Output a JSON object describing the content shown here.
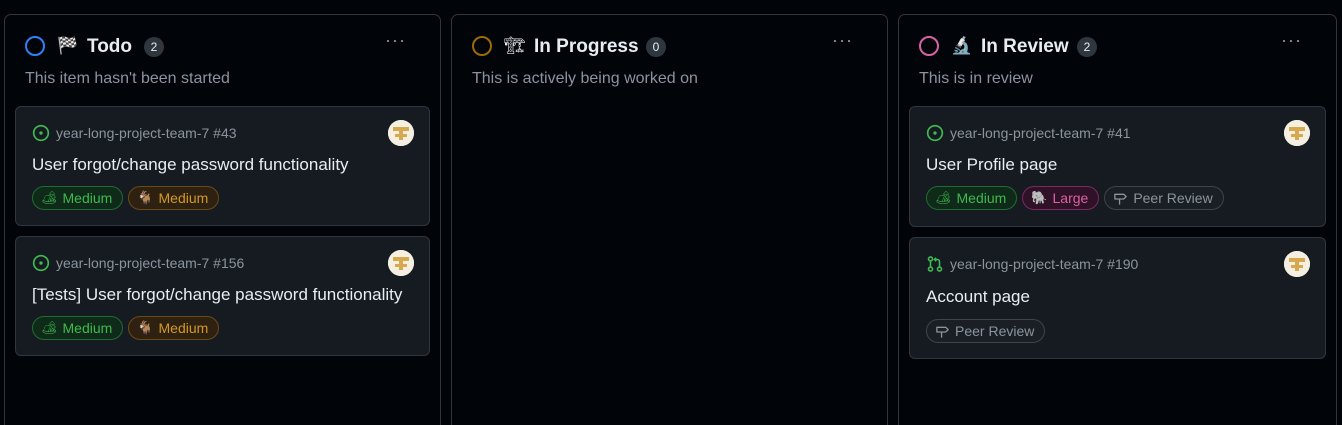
{
  "columns": [
    {
      "title": "Todo",
      "emoji": "🏁",
      "count": "2",
      "description": "This item hasn't been started",
      "dot_color": "#2f81f7",
      "cards": [
        {
          "meta": "year-long-project-team-7 #43",
          "title": "User forgot/change password functionality",
          "type": "issue",
          "labels": [
            {
              "emoji": "🏕",
              "text": "Medium",
              "color": "green"
            },
            {
              "emoji": "🐐",
              "text": "Medium",
              "color": "orange"
            }
          ]
        },
        {
          "meta": "year-long-project-team-7 #156",
          "title": "[Tests] User forgot/change password functionality",
          "type": "issue",
          "labels": [
            {
              "emoji": "🏕",
              "text": "Medium",
              "color": "green"
            },
            {
              "emoji": "🐐",
              "text": "Medium",
              "color": "orange"
            }
          ]
        }
      ]
    },
    {
      "title": "In Progress",
      "emoji": "🏗",
      "count": "0",
      "description": "This is actively being worked on",
      "dot_color": "#9e6a03",
      "cards": []
    },
    {
      "title": "In Review",
      "emoji": "🔬",
      "count": "2",
      "description": "This is in review",
      "dot_color": "#db61a2",
      "cards": [
        {
          "meta": "year-long-project-team-7 #41",
          "title": "User Profile page",
          "type": "issue",
          "labels": [
            {
              "emoji": "🏕",
              "text": "Medium",
              "color": "green"
            },
            {
              "emoji": "🐘",
              "text": "Large",
              "color": "pink"
            },
            {
              "icon": "signpost-icon",
              "text": "Peer Review",
              "color": "gray"
            }
          ]
        },
        {
          "meta": "year-long-project-team-7 #190",
          "title": "Account page",
          "type": "pull-request",
          "labels": [
            {
              "icon": "signpost-icon",
              "text": "Peer Review",
              "color": "gray"
            }
          ]
        }
      ]
    }
  ],
  "more_icon": "···",
  "colors": {
    "issue_open": "#3fb950",
    "background": "#010409",
    "card_bg": "#161b22",
    "border": "#30363d"
  }
}
